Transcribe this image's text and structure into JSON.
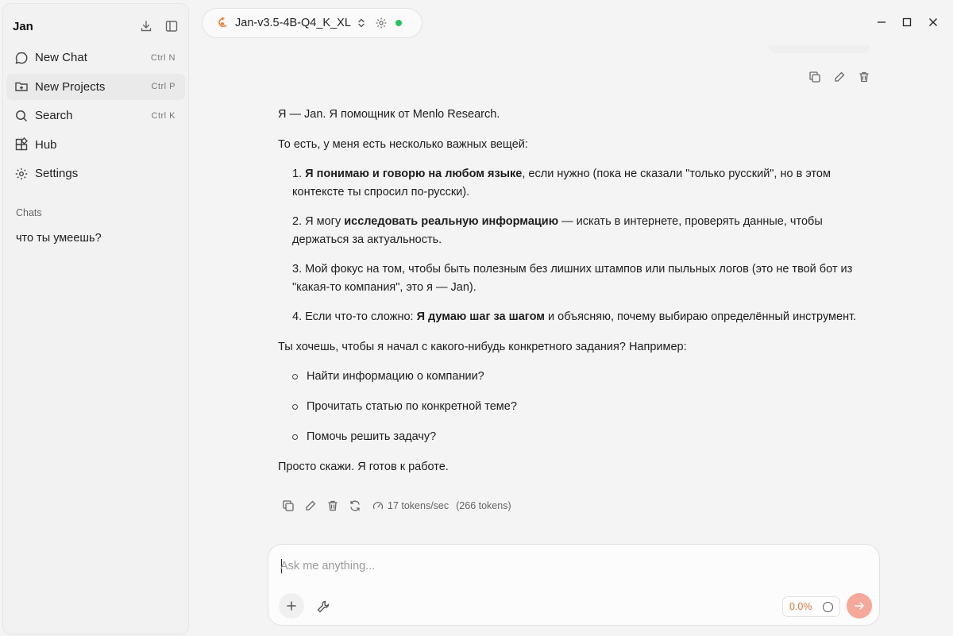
{
  "sidebar": {
    "title": "Jan",
    "nav": [
      {
        "label": "New Chat",
        "shortcut": "Ctrl  N"
      },
      {
        "label": "New Projects",
        "shortcut": "Ctrl  P"
      },
      {
        "label": "Search",
        "shortcut": "Ctrl  K"
      },
      {
        "label": "Hub",
        "shortcut": ""
      },
      {
        "label": "Settings",
        "shortcut": ""
      }
    ],
    "chats_label": "Chats",
    "chats": [
      "что ты умеешь?"
    ]
  },
  "header": {
    "model_name": "Jan-v3.5-4B-Q4_K_XL",
    "status_color": "#22c55e"
  },
  "message": {
    "intro": "Я — Jan. Я помощник от Menlo Research.",
    "lead": "То есть, у меня есть несколько важных вещей:",
    "points": [
      {
        "num": "1. ",
        "pre": "",
        "bold": "Я понимаю и говорю на любом языке",
        "post": ", если нужно (пока не сказали \"только русский\", но в этом контексте ты спросил по-русски)."
      },
      {
        "num": "2. ",
        "pre": "Я могу ",
        "bold": "исследовать реальную информацию",
        "post": " — искать в интернете, проверять данные, чтобы держаться за актуальность."
      },
      {
        "num": "3. ",
        "pre": "Мой фокус на том, чтобы быть полезным без лишних штампов или пыльных логов (это не твой бот из \"какая-то компания\", это я — Jan).",
        "bold": "",
        "post": ""
      },
      {
        "num": "4. ",
        "pre": "Если что-то сложно: ",
        "bold": "Я думаю шаг за шагом",
        "post": " и объясняю, почему выбираю определённый инструмент."
      }
    ],
    "question": "Ты хочешь, чтобы я начал с какого-нибудь конкретного задания? Например:",
    "examples": [
      "Найти информацию о компании?",
      "Прочитать статью по конкретной теме?",
      "Помочь решить задачу?"
    ],
    "closing": "Просто скажи. Я готов к работе.",
    "speed": "17 tokens/sec",
    "token_count": "(266 tokens)"
  },
  "composer": {
    "placeholder": "Ask me anything...",
    "value": "",
    "context_usage": "0.0%",
    "accent_color": "#f6a89a"
  },
  "icons": {
    "sidebar": [
      "download-icon",
      "sidebar-toggle-icon"
    ],
    "nav": [
      "chat-bubble-icon",
      "folder-plus-icon",
      "search-icon",
      "hub-grid-icon",
      "gear-icon"
    ],
    "window": [
      "minimize-icon",
      "maximize-icon",
      "close-icon"
    ],
    "message_actions": [
      "copy-icon",
      "edit-icon",
      "trash-icon",
      "regenerate-icon",
      "speed-gauge-icon"
    ],
    "composer": [
      "plus-icon",
      "tools-icon",
      "send-arrow-icon"
    ]
  }
}
